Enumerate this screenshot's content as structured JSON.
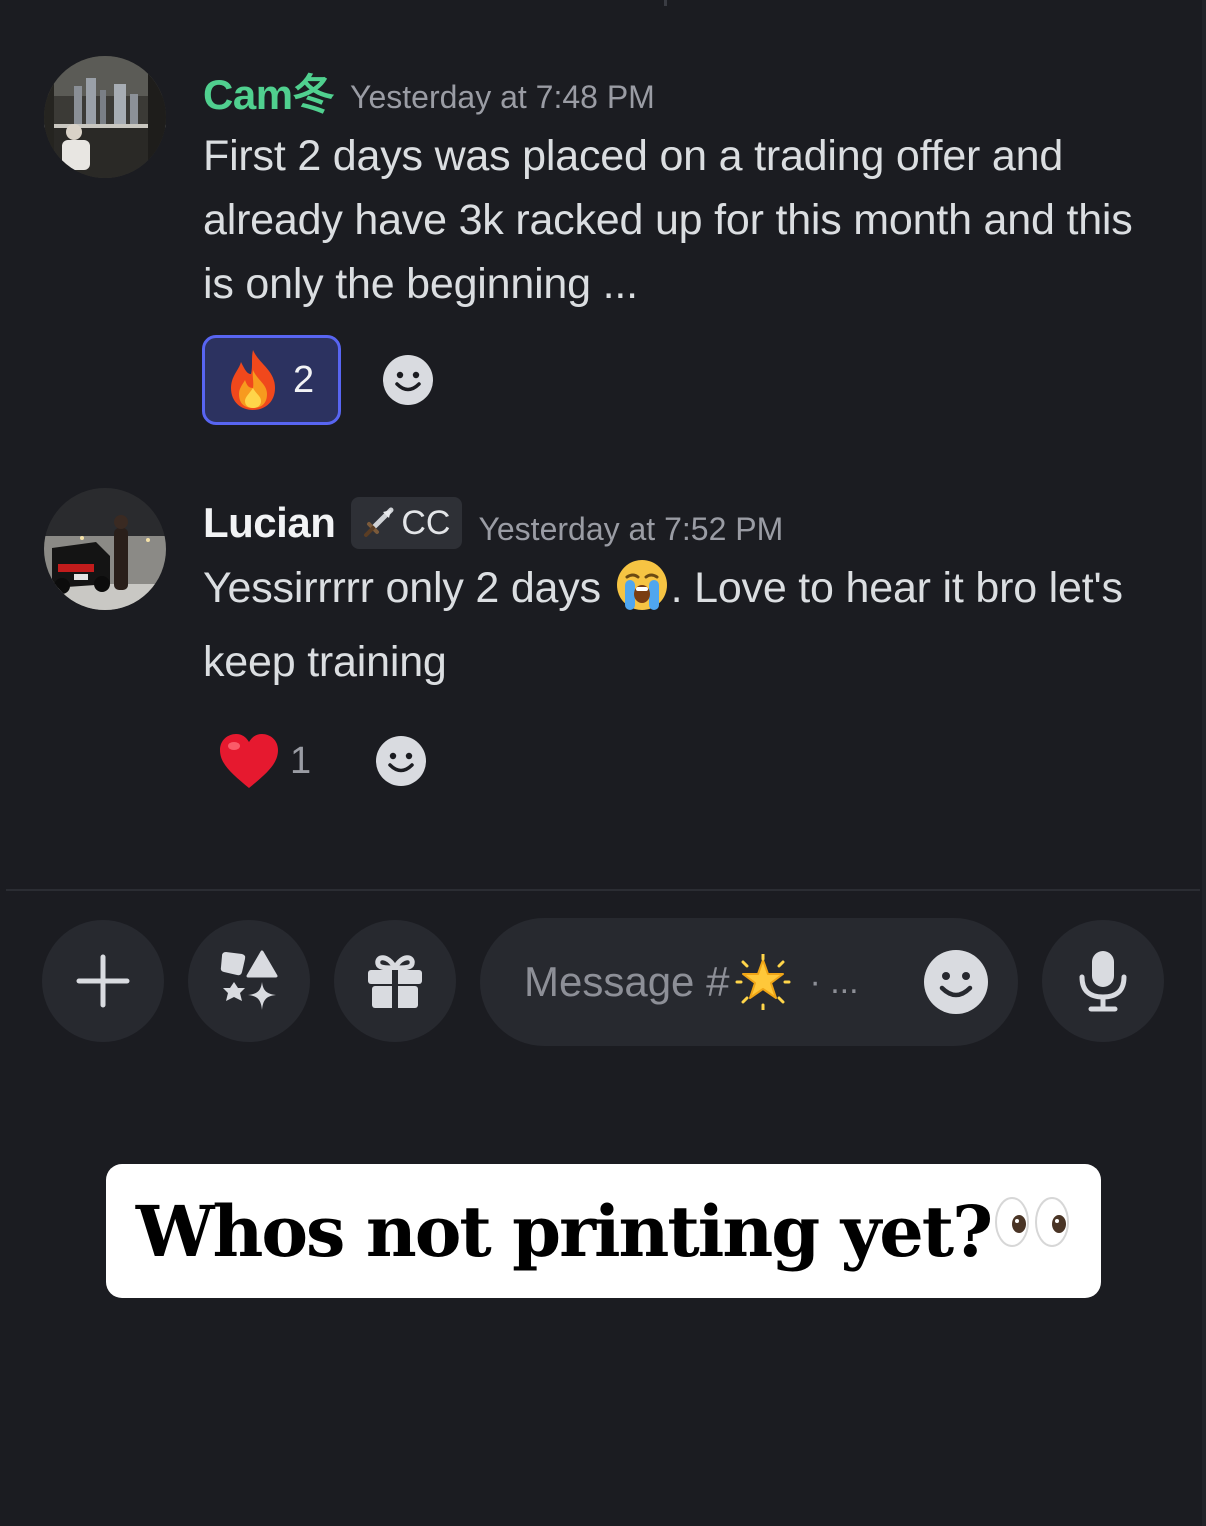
{
  "colors": {
    "background": "#1b1c21",
    "username_green": "#50d08f",
    "reaction_active_border": "#5865f2",
    "reaction_active_bg": "#2c3260",
    "control_bg": "#27292f"
  },
  "messages": [
    {
      "author": "Cam冬",
      "timestamp": "Yesterday at 7:48 PM",
      "text": "First 2 days was placed on a trading offer and already have 3k racked up for this month and this is only the beginning ...",
      "avatar_icon": "city-balcony-photo-avatar",
      "reactions": [
        {
          "emoji": "🔥",
          "icon": "fire-icon",
          "count": "2",
          "active": true
        }
      ]
    },
    {
      "author": "Lucian",
      "role_tag": "CC",
      "role_icon": "sword-icon",
      "timestamp": "Yesterday at 7:52 PM",
      "text_before": "Yessirrrrr only 2 days ",
      "inline_emoji": "😭",
      "text_after": ". Love to hear it bro let's keep training",
      "avatar_icon": "car-night-photo-avatar",
      "reactions": [
        {
          "emoji": "❤️",
          "icon": "heart-icon",
          "count": "1",
          "active": false
        }
      ]
    }
  ],
  "composer": {
    "placeholder_prefix": "Message #",
    "placeholder_emoji": "🌟",
    "placeholder_suffix": "· ...",
    "buttons": [
      "plus-icon",
      "apps-icon",
      "gift-icon",
      "microphone-icon"
    ]
  },
  "caption": {
    "text": "Whos not printing yet?",
    "emoji": "👀"
  }
}
